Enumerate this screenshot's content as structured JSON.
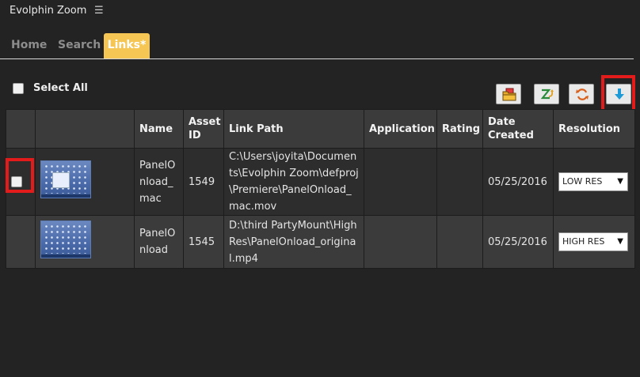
{
  "app": {
    "title": "Evolphin Zoom",
    "menu_icon": "hamburger-menu-icon"
  },
  "tabs": [
    {
      "label": "Home",
      "active": false
    },
    {
      "label": "Search",
      "active": false
    },
    {
      "label": "Links*",
      "active": true
    }
  ],
  "select_all": {
    "label": "Select All",
    "checked": false
  },
  "toolbar": {
    "buttons": [
      {
        "name": "open-folder-button",
        "icon": "folder-icon"
      },
      {
        "name": "zoom-button",
        "icon": "zoom-logo-icon"
      },
      {
        "name": "refresh-button",
        "icon": "refresh-icon"
      },
      {
        "name": "download-button",
        "icon": "download-arrow-icon"
      }
    ]
  },
  "table": {
    "headers": {
      "name": "Name",
      "asset_id": "Asset ID",
      "link_path": "Link Path",
      "application": "Application",
      "rating": "Rating",
      "date_created": "Date Created",
      "resolution": "Resolution"
    },
    "rows": [
      {
        "checked": false,
        "name": "PanelOnload_mac",
        "asset_id": "1549",
        "link_path": "C:\\Users\\joyita\\Documents\\Evolphin Zoom\\defproj\\Premiere\\PanelOnload_mac.mov",
        "application": "",
        "rating": "",
        "date_created": "05/25/2016",
        "resolution": "LOW RES"
      },
      {
        "checked": false,
        "name": "PanelOnload",
        "asset_id": "1545",
        "link_path": "D:\\third PartyMount\\HighRes\\PanelOnload_original.mp4",
        "application": "",
        "rating": "",
        "date_created": "05/25/2016",
        "resolution": "HIGH RES"
      }
    ]
  },
  "highlight_color": "#e31b1b",
  "accent_color": "#f6c654"
}
